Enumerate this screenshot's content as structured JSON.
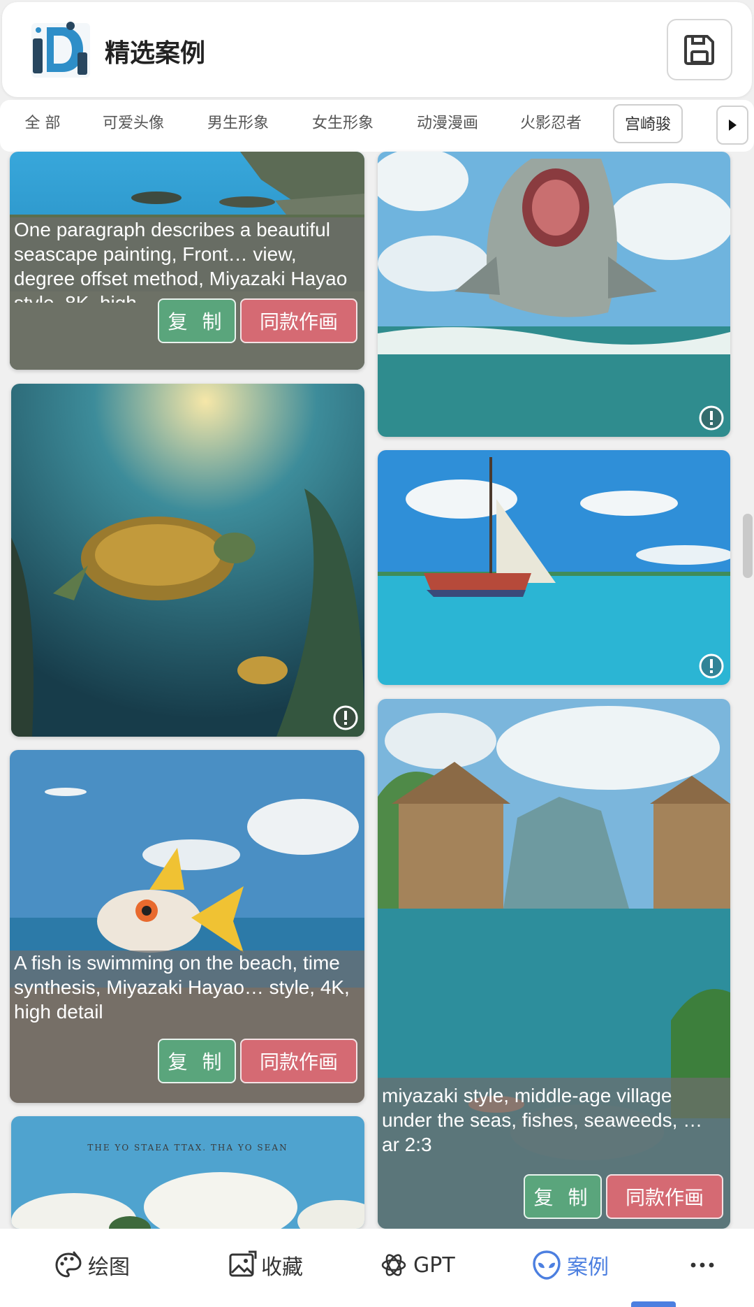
{
  "header": {
    "title": "精选案例"
  },
  "tabs": [
    {
      "label": "全 部"
    },
    {
      "label": "可爱头像"
    },
    {
      "label": "男生形象"
    },
    {
      "label": "女生形象"
    },
    {
      "label": "动漫漫画"
    },
    {
      "label": "火影忍者"
    },
    {
      "label": "宫崎骏",
      "selected": true
    }
  ],
  "cards": [
    {
      "description": "One paragraph describes a beautiful seascape painting, Front… view, degree offset method, Miyazaki Hayao style, 8K, high",
      "copy_label": "复 制",
      "same_label": "同款作画"
    },
    {
      "description": "A fish is swimming on the beach, time synthesis, Miyazaki Hayao… style, 4K, high detail",
      "copy_label": "复 制",
      "same_label": "同款作画"
    },
    {
      "description": "miyazaki style, middle-age village under the seas, fishes, seaweeds, … ar 2:3",
      "copy_label": "复 制",
      "same_label": "同款作画"
    }
  ],
  "poster_text": "THE YO STAEA TTAX. THA YO SEAN",
  "bottom_nav": [
    {
      "label": "绘图",
      "icon": "palette-icon"
    },
    {
      "label": "收藏",
      "icon": "gallery-icon"
    },
    {
      "label": "GPT",
      "icon": "openai-icon"
    },
    {
      "label": "案例",
      "icon": "alien-icon",
      "active": true
    },
    {
      "label": "···",
      "icon": "more-icon"
    }
  ],
  "colors": {
    "accent": "#4c7fe0",
    "copy_green": "#5aa57c",
    "same_red": "#d56a73"
  }
}
